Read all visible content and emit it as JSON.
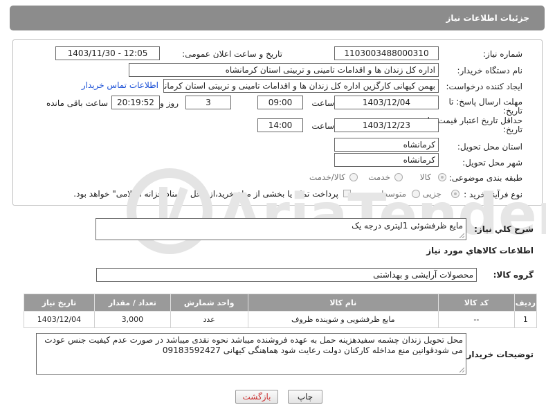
{
  "header": {
    "title": "جزئیات اطلاعات نیاز"
  },
  "fields": {
    "need_number": {
      "label": "شماره نیاز:",
      "value": "1103003488000310"
    },
    "announce_datetime": {
      "label": "تاریخ و ساعت اعلان عمومی:",
      "value": "1403/11/30 - 12:05"
    },
    "buyer_org": {
      "label": "نام دستگاه خریدار:",
      "value": "اداره کل زندان ها و اقدامات تامینی و تربیتی استان کرمانشاه"
    },
    "requester": {
      "label": "ایجاد کننده درخواست:",
      "value": "بهمن کیهانی کارگزین اداره کل زندان ها و اقدامات تامینی و تربیتی استان کرمانشاه",
      "contact_link": "اطلاعات تماس خریدار"
    },
    "reply_deadline": {
      "label_line1": "مهلت ارسال پاسخ: تا",
      "label_line2": "تاریخ:",
      "date": "1403/12/04",
      "time_label": "ساعت",
      "time": "09:00",
      "days": "3",
      "days_label": "روز و",
      "remaining": "20:19:52",
      "remaining_label": "ساعت باقی مانده"
    },
    "price_validity": {
      "label_line1": "حداقل تاریخ اعتبار قیمت: تا",
      "label_line2": "تاریخ:",
      "date": "1403/12/23",
      "time_label": "ساعت",
      "time": "14:00"
    },
    "delivery_province": {
      "label": "استان محل تحویل:",
      "value": "کرمانشاه"
    },
    "delivery_city": {
      "label": "شهر محل تحویل:",
      "value": "کرمانشاه"
    },
    "category": {
      "label": "طبقه بندی موضوعی:",
      "options": [
        "کالا",
        "خدمت",
        "کالا/خدمت"
      ]
    },
    "purchase_type": {
      "label": "نوع فرآیند خرید :",
      "options": [
        "جزیی",
        "متوسط"
      ],
      "payment_note": "پرداخت تمام یا بخشی از مبلغ خرید،از محل \"اسناد خزانه اسلامی\" خواهد بود."
    }
  },
  "summary": {
    "label": "شرح کلي نياز:",
    "value": "مایع ظرفشوئی 1لیتری درجه یک"
  },
  "goods_section": {
    "title": "اطلاعات کالاهاي مورد نياز"
  },
  "goods_group": {
    "label": "گروه کالا:",
    "value": "محصولات آرایشی و بهداشتی"
  },
  "table": {
    "headers": [
      "ردیف",
      "کد کالا",
      "نام کالا",
      "واحد شمارش",
      "تعداد / مقدار",
      "تاریخ نیاز"
    ],
    "rows": [
      [
        "1",
        "--",
        "مایع ظرفشویی و شوینده ظروف",
        "عدد",
        "3,000",
        "1403/12/04"
      ]
    ]
  },
  "buyer_notes": {
    "label": "توضیحات خریدار:",
    "line1": "محل تحویل زندان چشمه سفیدهزینه حمل به عهده فروشنده میباشد نحوه نقدی میباشد در صورت عدم کیفیت جنس عودت",
    "line2": "می شودقوانین منع مداخله کارکنان دولت رعایت شود هماهنگی کیهانی  09183592427"
  },
  "buttons": {
    "print": "چاپ",
    "back": "بازگشت"
  },
  "watermark": {
    "text": "AriaTender.neT"
  },
  "colors": {
    "header_bg": "#8c8c8c",
    "link": "#1a4fd6",
    "back_text": "#cc3333"
  }
}
